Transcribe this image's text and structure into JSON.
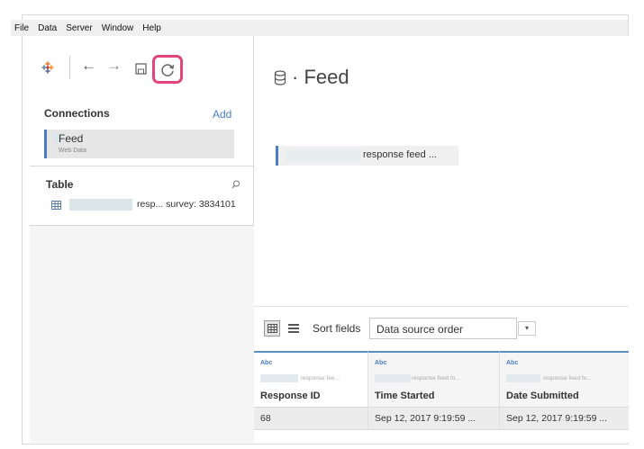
{
  "menu": [
    "File",
    "Data",
    "Server",
    "Window",
    "Help"
  ],
  "toolbar": {
    "back_glyph": "←",
    "forward_glyph": "→",
    "icons": [
      "tableau-logo-icon",
      "back-arrow-icon",
      "forward-arrow-icon",
      "save-icon",
      "refresh-icon"
    ],
    "highlight_color": "#e0457b"
  },
  "connections": {
    "title": "Connections",
    "add_label": "Add",
    "item": {
      "name": "Feed",
      "type": "Web Data"
    }
  },
  "table_panel": {
    "title": "Table",
    "item_label": "resp... survey: 3834101"
  },
  "canvas": {
    "title": "Feed",
    "title_prefix": "·",
    "table_chip": "response feed ..."
  },
  "grid_controls": {
    "sort_label": "Sort fields",
    "sort_value": "Data source order",
    "sort_arrow": "▾"
  },
  "columns": [
    {
      "type": "Abc",
      "source": "response fee...",
      "name": "Response ID"
    },
    {
      "type": "Abc",
      "source": "response feed fo...",
      "name": "Time Started"
    },
    {
      "type": "Abc",
      "source": "response feed fo...",
      "name": "Date Submitted"
    }
  ],
  "rows": [
    [
      "68",
      "Sep 12, 2017 9:19:59 ...",
      "Sep 12, 2017 9:19:59 ..."
    ]
  ],
  "colors": {
    "accent": "#4b7cc6",
    "header_rule": "#5a8fc0"
  }
}
